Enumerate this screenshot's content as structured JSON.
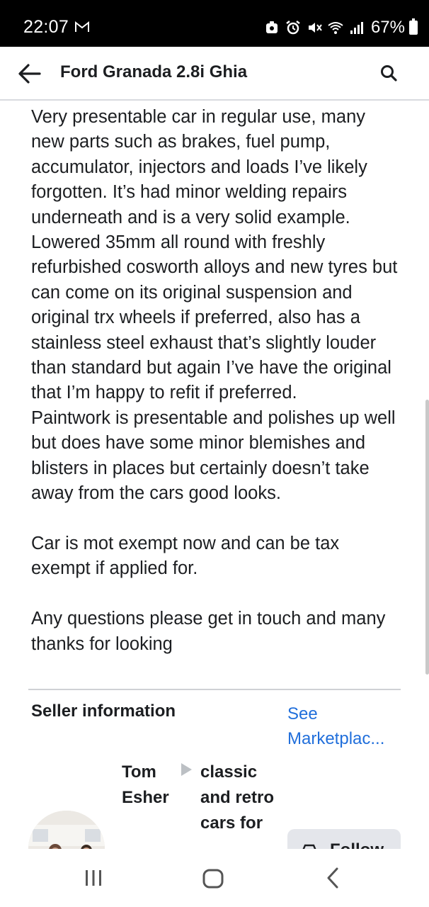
{
  "status_bar": {
    "time": "22:07",
    "battery": "67%"
  },
  "header": {
    "title": "Ford Granada 2.8i Ghia",
    "back_icon": "arrow-left-icon",
    "search_icon": "search-icon"
  },
  "listing": {
    "description": "Very presentable car in regular use, many new parts such as brakes, fuel pump, accumulator, injectors and loads I’ve likely forgotten. It’s had minor welding repairs underneath and is a very solid example.\nLowered 35mm all round with freshly refurbished cosworth alloys and new tyres but can come on its original suspension and original trx wheels if preferred, also has a stainless steel exhaust that’s slightly louder than standard but again I’ve have the original that I’m happy to refit if preferred.\nPaintwork is presentable and polishes up well but does have some minor blemishes and blisters in places but certainly doesn’t take away from the cars good looks.\n\nCar is mot exempt now and can be tax exempt if applied for.\n\nAny questions please get in touch and many thanks for looking"
  },
  "seller": {
    "heading": "Seller information",
    "see_link": "See Marketplac...",
    "name": "Tom Esher",
    "group": "classic and retro cars for",
    "follow_label": "Follow"
  },
  "colors": {
    "link": "#216fdb",
    "button_bg": "#e4e6eb",
    "status_bar_bg": "#000000"
  }
}
